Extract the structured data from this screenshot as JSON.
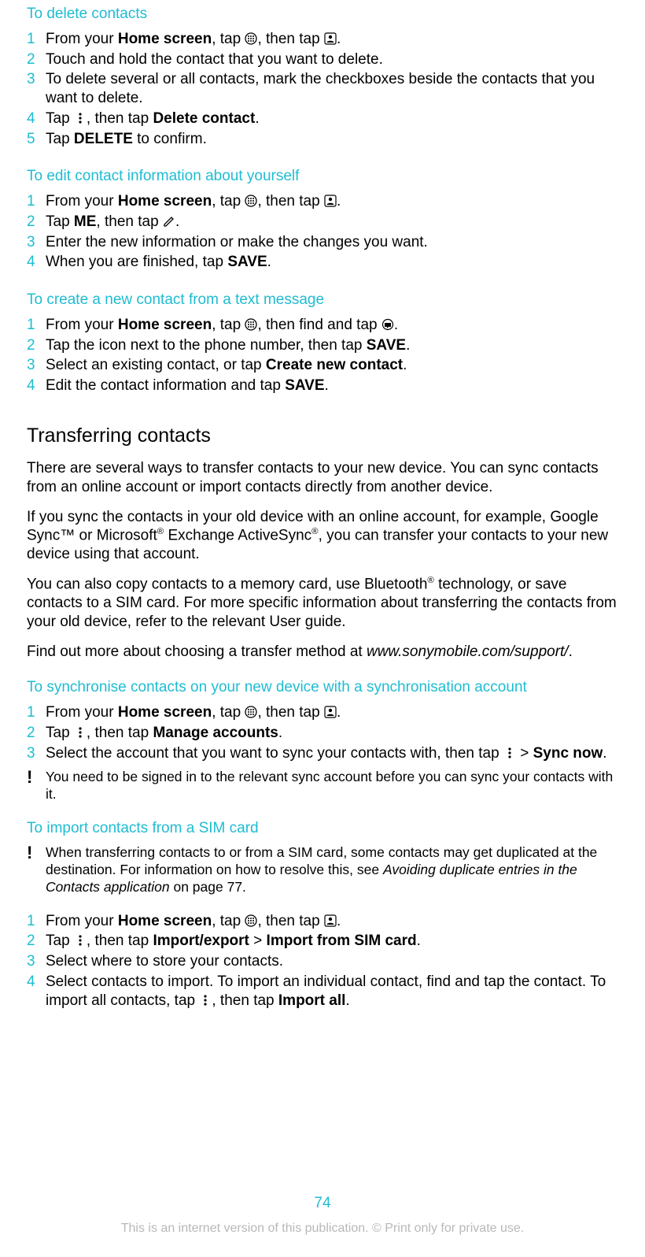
{
  "sections": {
    "delete": {
      "title": "To delete contacts",
      "steps": [
        {
          "n": "1",
          "pre": "From your ",
          "home": "Home screen",
          "mid1": ", tap ",
          "mid2": ", then tap ",
          "post": "."
        },
        {
          "n": "2",
          "plain": "Touch and hold the contact that you want to delete."
        },
        {
          "n": "3",
          "plain": "To delete several or all contacts, mark the checkboxes beside the contacts that you want to delete."
        },
        {
          "n": "4",
          "pre": "Tap ",
          "mid": ", then tap ",
          "bold": "Delete contact",
          "post": "."
        },
        {
          "n": "5",
          "pre": "Tap ",
          "bold": "DELETE",
          "post": " to confirm."
        }
      ]
    },
    "editSelf": {
      "title": "To edit contact information about yourself",
      "steps": [
        {
          "n": "1",
          "pre": "From your ",
          "home": "Home screen",
          "mid1": ", tap ",
          "mid2": ", then tap ",
          "post": "."
        },
        {
          "n": "2",
          "pre": "Tap ",
          "bold": "ME",
          "mid": ", then tap ",
          "post": "."
        },
        {
          "n": "3",
          "plain": "Enter the new information or make the changes you want."
        },
        {
          "n": "4",
          "pre": "When you are finished, tap ",
          "bold": "SAVE",
          "post": "."
        }
      ]
    },
    "fromText": {
      "title": "To create a new contact from a text message",
      "steps": [
        {
          "n": "1",
          "pre": "From your ",
          "home": "Home screen",
          "mid1": ", tap ",
          "mid2": ", then find and tap ",
          "post": "."
        },
        {
          "n": "2",
          "pre": "Tap the icon next to the phone number, then tap ",
          "bold": "SAVE",
          "post": "."
        },
        {
          "n": "3",
          "pre": "Select an existing contact, or tap ",
          "bold": "Create new contact",
          "post": "."
        },
        {
          "n": "4",
          "pre": "Edit the contact information and tap ",
          "bold": "SAVE",
          "post": "."
        }
      ]
    },
    "transfer": {
      "title": "Transferring contacts",
      "p1": "There are several ways to transfer contacts to your new device. You can sync contacts from an online account or import contacts directly from another device.",
      "p2a": "If you sync the contacts in your old device with an online account, for example, Google Sync™ or Microsoft",
      "p2b": " Exchange ActiveSync",
      "p2c": ", you can transfer your contacts to your new device using that account.",
      "p3a": "You can also copy contacts to a memory card, use Bluetooth",
      "p3b": " technology, or save contacts to a SIM card. For more specific information about transferring the contacts from your old device, refer to the relevant User guide.",
      "p4a": "Find out more about choosing a transfer method at ",
      "p4link": "www.sonymobile.com/support/",
      "p4b": "."
    },
    "sync": {
      "title": "To synchronise contacts on your new device with a synchronisation account",
      "steps": [
        {
          "n": "1",
          "pre": "From your ",
          "home": "Home screen",
          "mid1": ", tap ",
          "mid2": ", then tap ",
          "post": "."
        },
        {
          "n": "2",
          "pre": "Tap ",
          "mid": ", then tap ",
          "bold": "Manage accounts",
          "post": "."
        },
        {
          "n": "3",
          "pre": "Select the account that you want to sync your contacts with, then tap ",
          "gt": " > ",
          "bold": "Sync now",
          "post": "."
        }
      ],
      "note": "You need to be signed in to the relevant sync account before you can sync your contacts with it."
    },
    "sim": {
      "title": "To import contacts from a SIM card",
      "note_a": "When transferring contacts to or from a SIM card, some contacts may get duplicated at the destination. For information on how to resolve this, see ",
      "note_link": "Avoiding duplicate entries in the Contacts application",
      "note_b": " on page 77.",
      "steps": [
        {
          "n": "1",
          "pre": "From your ",
          "home": "Home screen",
          "mid1": ", tap ",
          "mid2": ", then tap ",
          "post": "."
        },
        {
          "n": "2",
          "pre": "Tap ",
          "mid": ", then tap ",
          "bold1": "Import/export",
          "gt": " > ",
          "bold2": "Import from SIM card",
          "post": "."
        },
        {
          "n": "3",
          "plain": "Select where to store your contacts."
        },
        {
          "n": "4",
          "pre": "Select contacts to import. To import an individual contact, find and tap the contact. To import all contacts, tap ",
          "mid": ", then tap ",
          "bold": "Import all",
          "post": "."
        }
      ]
    }
  },
  "page": "74",
  "footer": "This is an internet version of this publication. © Print only for private use.",
  "sup_r": "®"
}
